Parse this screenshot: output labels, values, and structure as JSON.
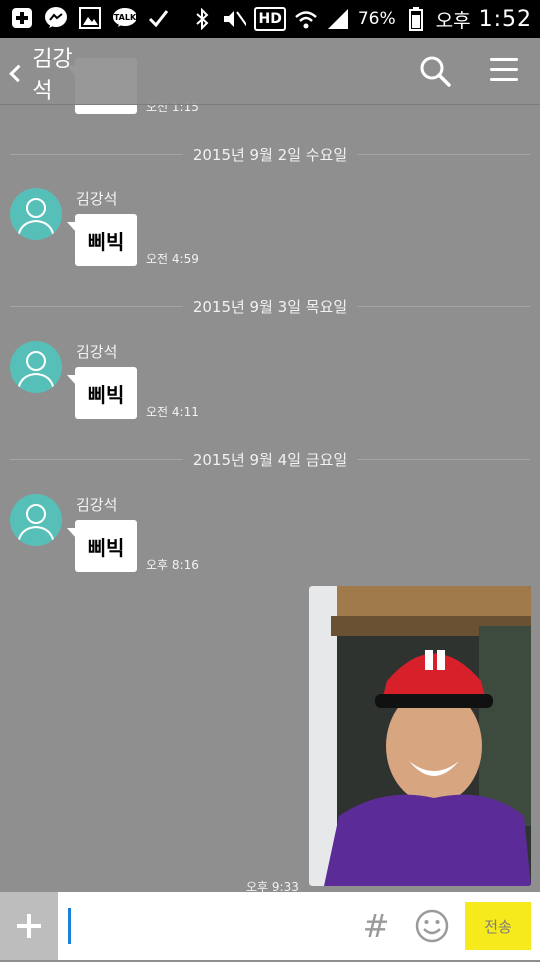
{
  "status_bar": {
    "battery": "76%",
    "ampm": "오후",
    "time": "1:52",
    "network": "HD"
  },
  "header": {
    "title": "김강석"
  },
  "partial_top": {
    "time": "오전 1:15"
  },
  "dates": [
    "2015년 9월 2일 수요일",
    "2015년 9월 3일 목요일",
    "2015년 9월 4일 금요일"
  ],
  "messages": [
    {
      "sender": "김강석",
      "text": "삐빅",
      "time": "오전 4:59"
    },
    {
      "sender": "김강석",
      "text": "삐빅",
      "time": "오전 4:11"
    },
    {
      "sender": "김강석",
      "text": "삐빅",
      "time": "오후 8:16"
    }
  ],
  "photo_message": {
    "time": "오후 9:33"
  },
  "input": {
    "value": "",
    "hash": "#",
    "send_label": "전송"
  },
  "colors": {
    "chat_bg": "#8f8f8f",
    "avatar": "#56c0b8",
    "send": "#f6ea1c"
  }
}
